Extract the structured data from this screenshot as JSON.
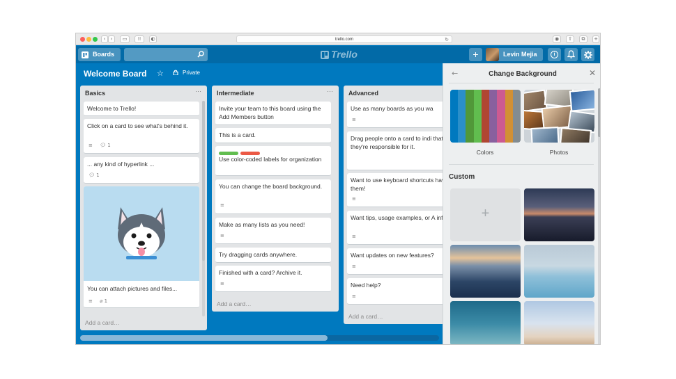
{
  "browser": {
    "url": "trello.com",
    "reload_glyph": "↻",
    "back_glyph": "‹",
    "forward_glyph": "›"
  },
  "header": {
    "boards_label": "Boards",
    "search_placeholder": "",
    "logo_text": "Trello",
    "add_glyph": "+",
    "user_name": "Levin Mejia",
    "info_glyph": "i"
  },
  "board": {
    "title": "Welcome Board",
    "star_glyph": "☆",
    "visibility": "Private"
  },
  "lists": [
    {
      "title": "Basics",
      "menu": "···",
      "add_card": "Add a card…",
      "cards": [
        {
          "text": "Welcome to Trello!"
        },
        {
          "text": "Click on a card to see what's behind it.",
          "comments": "1"
        },
        {
          "text": "... any kind of hyperlink ...",
          "comments": "1"
        },
        {
          "text": "You can attach pictures and files...",
          "attachments": "1"
        }
      ]
    },
    {
      "title": "Intermediate",
      "menu": "···",
      "add_card": "Add a card…",
      "cards": [
        {
          "text": "Invite your team to this board using the Add Members button"
        },
        {
          "text": "This is a card."
        },
        {
          "text": "Use color-coded labels for organization"
        },
        {
          "text": "You can change the board background."
        },
        {
          "text": "Make as many lists as you need!"
        },
        {
          "text": "Try dragging cards anywhere."
        },
        {
          "text": "Finished with a card? Archive it."
        }
      ]
    },
    {
      "title": "Advanced",
      "add_card": "Add a card…",
      "cards": [
        {
          "text": "Use as many boards as you wa"
        },
        {
          "text": "Drag people onto a card to indi that they're responsible for it."
        },
        {
          "text": "Want to use keyboard shortcuts have them!"
        },
        {
          "text": "Want tips, usage examples, or A info?"
        },
        {
          "text": "Want updates on new features?"
        },
        {
          "text": "Need help?"
        }
      ]
    }
  ],
  "panel": {
    "title": "Change Background",
    "back_glyph": "←",
    "close_glyph": "✕",
    "colors_caption": "Colors",
    "photos_caption": "Photos",
    "custom_label": "Custom",
    "add_glyph": "+"
  },
  "colors": {
    "board_bg": "#0079bf",
    "header_bg": "#026aa7",
    "list_bg": "#e2e4e6",
    "label_green": "#61bd4f",
    "label_red": "#eb5a46",
    "swatches": [
      "#0079bf",
      "#2b8fc9",
      "#519839",
      "#61bd4f",
      "#b04632",
      "#89609e",
      "#cd5a91",
      "#d29034",
      "#838c91"
    ]
  }
}
